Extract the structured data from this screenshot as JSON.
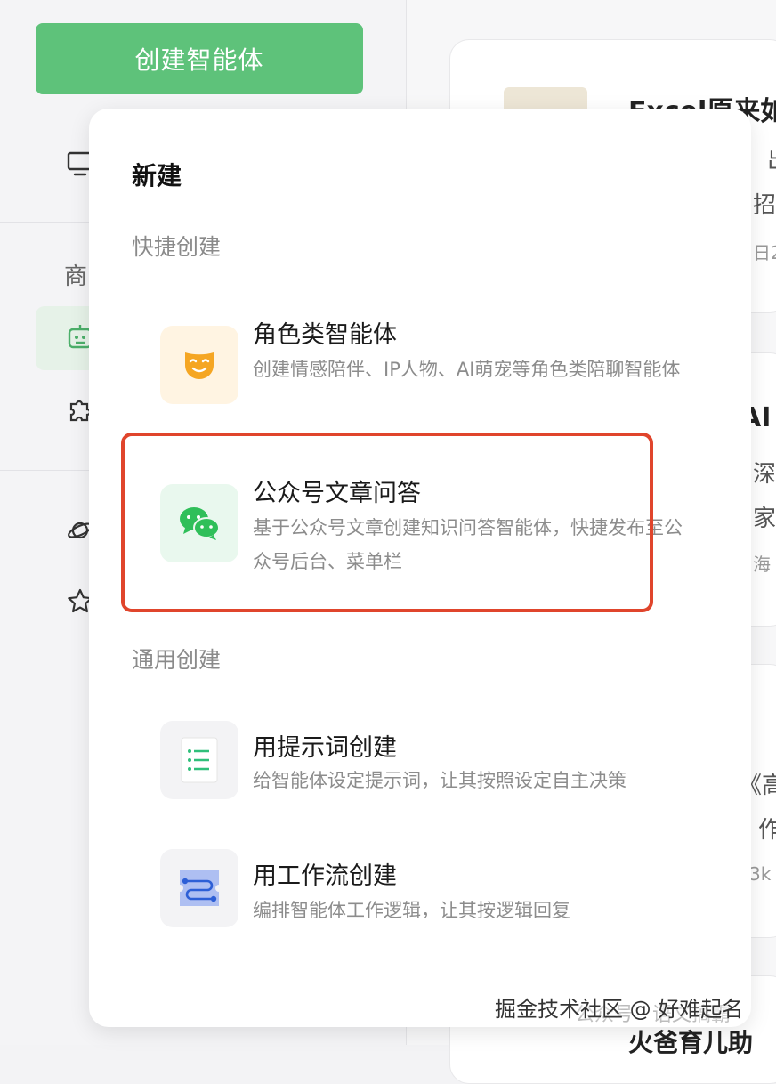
{
  "sidebar": {
    "create_button": "创建智能体",
    "section_text": "商"
  },
  "popover": {
    "title": "新建",
    "quick_section": "快捷创建",
    "general_section": "通用创建",
    "items": [
      {
        "title": "角色类智能体",
        "desc": "创建情感陪伴、IP人物、AI萌宠等角色类陪聊智能体",
        "icon": "mask-icon"
      },
      {
        "title": "公众号文章问答",
        "desc": "基于公众号文章创建知识问答智能体，快捷发布至公众号后台、菜单栏",
        "icon": "wechat-icon"
      },
      {
        "title": "用提示词创建",
        "desc": "给智能体设定提示词，让其按照设定自主决策",
        "icon": "list-doc-icon"
      },
      {
        "title": "用工作流创建",
        "desc": "编排智能体工作逻辑，让其按逻辑回复",
        "icon": "workflow-icon"
      }
    ]
  },
  "background": {
    "card1_title": "Excel原来如",
    "card1_line1": "出",
    "card1_line2": "招",
    "card1_meta": "日2",
    "card2_title": "AI",
    "card2_line1": "深",
    "card2_line2": "家",
    "card2_meta": "海",
    "card3_line1": "《高",
    "card3_line2": "作",
    "card3_meta": "3k",
    "card4_title": "火爸育儿助"
  },
  "watermark": {
    "text": "掘金技术社区 @ 好难起名",
    "faint": "公众号 · 语文搞霸"
  },
  "colors": {
    "accent_green": "#5ec27a",
    "highlight_red": "#e0452c"
  }
}
